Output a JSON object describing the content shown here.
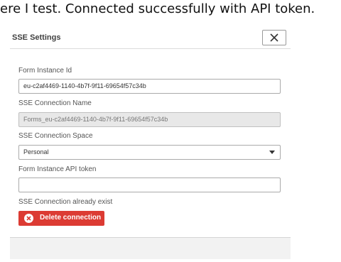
{
  "caption": "ere I test. Connected successfully with API token.",
  "dialog": {
    "title": "SSE Settings",
    "close_icon": "close-icon"
  },
  "form": {
    "instance_id": {
      "label": "Form Instance Id",
      "value": "eu-c2af4469-1140-4b7f-9f11-69654f57c34b"
    },
    "connection_name": {
      "label": "SSE Connection Name",
      "value": "Forms_eu-c2af4469-1140-4b7f-9f11-69654f57c34b"
    },
    "connection_space": {
      "label": "SSE Connection Space",
      "value": "Personal"
    },
    "api_token": {
      "label": "Form Instance API token",
      "value": ""
    },
    "connection_status": {
      "label": "SSE Connection already exist"
    },
    "delete_button": {
      "label": "Delete connection",
      "color": "#dc3b33",
      "icon": "close-circle-icon"
    }
  }
}
